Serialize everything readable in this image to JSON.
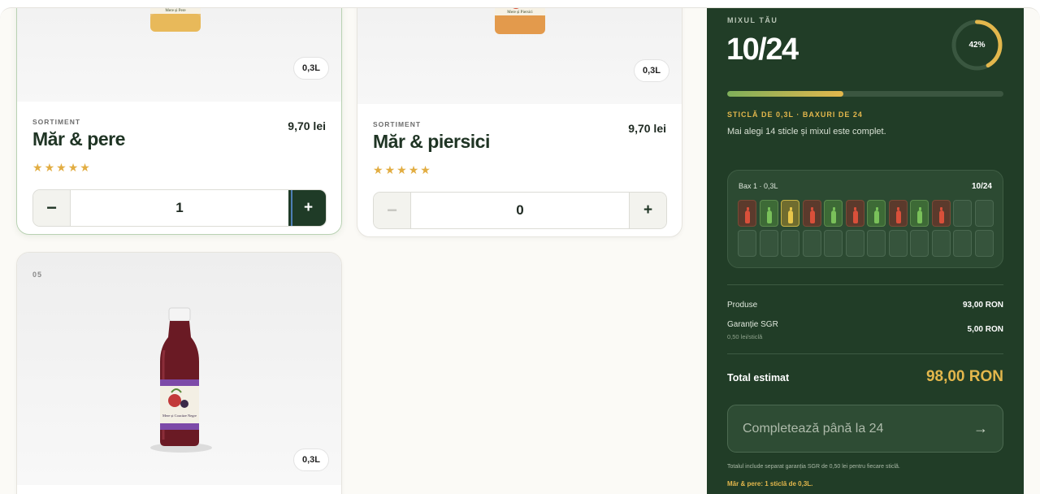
{
  "products": [
    {
      "kicker": "SORTIMENT",
      "name": "Măr & pere",
      "price": "9,70 lei",
      "rating": 5,
      "size": "0,3L",
      "quantity": "1",
      "minus": "−",
      "plus": "+",
      "jar_label": "Mere și Pere",
      "stars": [
        "★",
        "★",
        "★",
        "★",
        "★"
      ]
    },
    {
      "kicker": "SORTIMENT",
      "name": "Măr & piersici",
      "price": "9,70 lei",
      "rating": 5,
      "size": "0,3L",
      "quantity": "0",
      "minus": "−",
      "plus": "+",
      "jar_label": "Mere și Piersici",
      "stars": [
        "★",
        "★",
        "★",
        "★",
        "★"
      ]
    },
    {
      "number": "05",
      "size": "0,3L",
      "jar_label": "Mere și Coacăze Negre"
    }
  ],
  "panel": {
    "label": "MIXUL TĂU",
    "count": "10/24",
    "progress_percent": 42,
    "progress_label": "42%",
    "subtitle": "STICLĂ DE 0,3L · BAXURI DE 24",
    "hint": "Mai alegi 14 sticle și mixul este complet.",
    "box": {
      "title": "Bax 1 · 0,3L",
      "count": "10/24",
      "slots": [
        "red",
        "green",
        "yellow",
        "red",
        "green",
        "red",
        "green",
        "red",
        "green",
        "red",
        "empty",
        "empty",
        "empty",
        "empty",
        "empty",
        "empty",
        "empty",
        "empty",
        "empty",
        "empty",
        "empty",
        "empty",
        "empty",
        "empty"
      ]
    },
    "products_label": "Produse",
    "products_value": "93,00 RON",
    "deposit_label": "Garanție SGR",
    "deposit_sub": "0,50 lei/sticlă",
    "deposit_value": "5,00 RON",
    "total_label": "Total estimat",
    "total_value": "98,00 RON",
    "cta_label": "Completează până la 24",
    "cta_arrow": "→",
    "footnote": "Totalul include separat garanția SGR de 0,50 lei pentru fiecare sticlă.",
    "mix_note": "Măr & pere: 1 sticlă de 0,3L."
  },
  "colors": {
    "panel_bg": "#213d27",
    "accent_gold": "#e3b74c",
    "brand_green": "#1f3424"
  }
}
